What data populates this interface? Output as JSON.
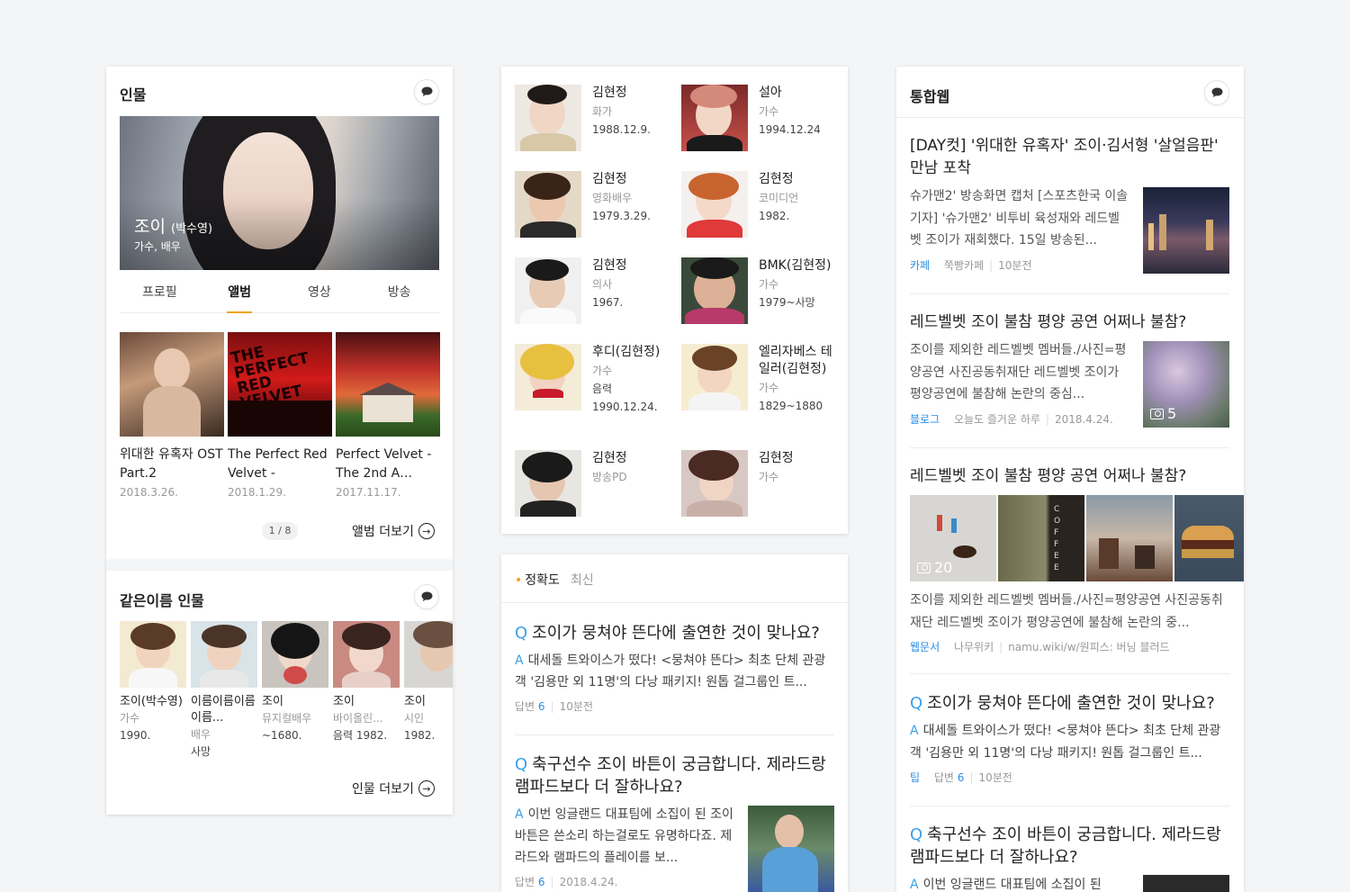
{
  "left": {
    "person_title": "인물",
    "hero": {
      "name": "조이",
      "name_extra": "(박수영)",
      "sub": "가수, 배우"
    },
    "tabs": [
      "프로필",
      "앨범",
      "영상",
      "방송"
    ],
    "active_tab": "앨범",
    "albums": [
      {
        "title": "위대한 유혹자 OST Part.2",
        "date": "2018.3.26."
      },
      {
        "title": "The Perfect Red Velvet -",
        "date": "2018.1.29."
      },
      {
        "title": "Perfect Velvet - The 2nd A…",
        "date": "2017.11.17."
      }
    ],
    "pager": "1 / 8",
    "album_more": "앨범 더보기",
    "same_name_title": "같은이름 인물",
    "same_name": [
      {
        "name": "조이(박수영)",
        "job": "가수",
        "year": "1990."
      },
      {
        "name": "이름이름이름이름...",
        "job": "배우",
        "year": "사망"
      },
      {
        "name": "조이",
        "job": "뮤지컬배우",
        "year": "~1680."
      },
      {
        "name": "조이",
        "job": "바이올린...",
        "year": "음력 1982."
      },
      {
        "name": "조이",
        "job": "시인",
        "year": "1982."
      }
    ],
    "person_more": "인물 더보기"
  },
  "middle": {
    "people": [
      {
        "name": "김현정",
        "job": "화가",
        "birth": "1988.12.9."
      },
      {
        "name": "설아",
        "job": "가수",
        "birth": "1994.12.24"
      },
      {
        "name": "김현정",
        "job": "영화배우",
        "birth": "1979.3.29."
      },
      {
        "name": "김현정",
        "job": "코미디언",
        "birth": "1982."
      },
      {
        "name": "김현정",
        "job": "의사",
        "birth": "1967."
      },
      {
        "name": "BMK(김현정)",
        "job": "가수",
        "birth": "1979~사망"
      },
      {
        "name": "후디(김현정)",
        "job": "가수",
        "birth": "음력 1990.12.24."
      },
      {
        "name": "엘리자베스 테일러(김현정)",
        "job": "가수",
        "birth": "1829~1880"
      },
      {
        "name": "김현정",
        "job": "방송PD",
        "birth": ""
      },
      {
        "name": "김현정",
        "job": "가수",
        "birth": ""
      }
    ],
    "sort": {
      "active": "정확도",
      "inactive": "최신"
    },
    "qa": [
      {
        "q": "조이가 뭉쳐야 뜬다에 출연한 것이 맞나요?",
        "a": "대세돌 트와이스가 떴다! <뭉쳐야 뜬다> 최초 단체 관광객 '김용만 외 11명'의 다낭 패키지! 원톱 걸그룹인 트...",
        "label": "답변",
        "count": "6",
        "time": "10분전"
      },
      {
        "q": "축구선수 조이 바튼이 궁금합니다. 제라드랑 램파드보다 더 잘하나요?",
        "a": "이번 잉글랜드 대표팀에 소집이 된 조이바튼은 쓴소리 하는걸로도 유명하다죠. 제라드와 램파드의 플레이를 보...",
        "label": "답변",
        "count": "6",
        "time": "2018.4.24."
      }
    ]
  },
  "right": {
    "title": "통합웹",
    "items": [
      {
        "title": "[DAY컷] '위대한 유혹자' 조이·김서형 '살얼음판' 만남 포착",
        "body": "슈가맨2' 방송화면 캡처 [스포츠한국 이솔 기자] '슈가맨2' 비투비 육성재와 레드벨벳 조이가 재회했다. 15일 방송된...",
        "tag": "카페",
        "source": "쭉빵카페",
        "time": "10분전"
      },
      {
        "title": "레드벨벳 조이 불참 평양 공연 어쩌나 불참?",
        "body": "조이를 제외한 레드벨벳 멤버들./사진=평양공연 사진공동취재단 레드벨벳 조이가 평양공연에 불참해 논란의 중심...",
        "tag": "블로그",
        "source": "오늘도 즐거운 하루",
        "time": "2018.4.24.",
        "photo_count": "5"
      },
      {
        "title": "레드벨벳 조이 불참 평양 공연 어쩌나 불참?",
        "body": "조이를 제외한 레드벨벳 멤버들./사진=평양공연 사진공동취재단 레드벨벳 조이가 평양공연에 불참해 논란의 중...",
        "tag": "웹문서",
        "source": "나무위키",
        "time": "namu.wiki/w/원피스: 버닝 블러드",
        "photo_count": "20"
      },
      {
        "title": "조이가 뭉쳐야 뜬다에 출연한 것이 맞나요?",
        "body": "대세돌 트와이스가 떴다! <뭉쳐야 뜬다> 최초 단체 관광객 '김용만 외 11명'의 다낭 패키지! 원톱 걸그룹인 트...",
        "tag": "팁",
        "label": "답변",
        "count": "6",
        "time": "10분전"
      },
      {
        "title": "축구선수 조이 바튼이 궁금합니다. 제라드랑 램파드보다 더 잘하나요?",
        "body": "이번 잉글랜드 대표팀에 소집이 된"
      }
    ]
  },
  "q_mark": "Q",
  "a_mark": "A",
  "colors": {
    "accent": "#f4a20c",
    "link": "#2a8ee6",
    "qa_mark": "#3aa0e8"
  }
}
